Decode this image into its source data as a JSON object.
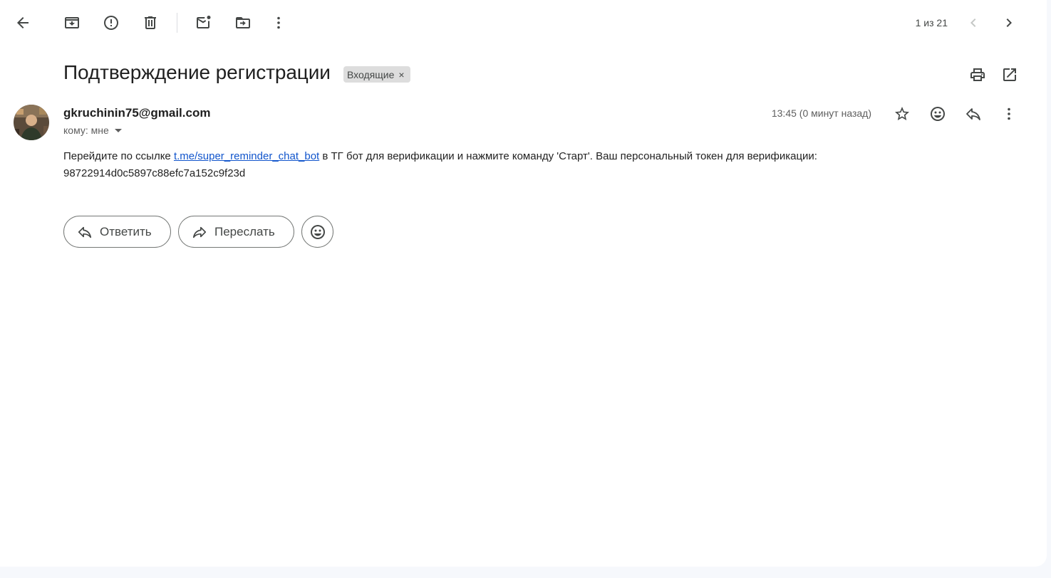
{
  "toolbar": {
    "back": "back-icon",
    "archive": "archive-icon",
    "spam": "report-spam-icon",
    "delete": "delete-icon",
    "mark_unread": "mark-unread-icon",
    "move_to": "move-to-icon",
    "more": "more-vert-icon",
    "pager_text": "1 из 21",
    "prev": "chevron-left-icon",
    "next": "chevron-right-icon"
  },
  "message": {
    "subject": "Подтверждение регистрации",
    "label": "Входящие",
    "label_remove": "×",
    "sender_email": "gkruchinin75@gmail.com",
    "recipient": "кому: мне",
    "timestamp": "13:45 (0 минут назад)",
    "body_before_link": "Перейдите по ссылке ",
    "link_text": "t.me/super_reminder_chat_bot",
    "body_after_link": " в ТГ бот для верификации и нажмите команду 'Старт'. Ваш персональный токен для верификации: 98722914d0c5897c88efc7a152c9f23d"
  },
  "actions": {
    "reply_label": "Ответить",
    "forward_label": "Переслать"
  },
  "colors": {
    "link": "#1155cc",
    "chip_bg": "#dddddd",
    "page_bg": "#f6f8fc"
  }
}
